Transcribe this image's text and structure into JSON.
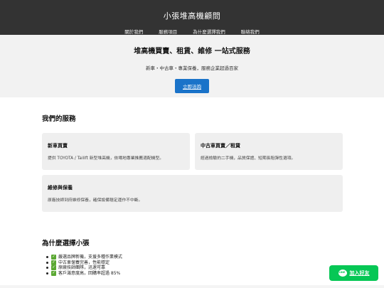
{
  "header": {
    "brand": "小張堆高機顧問",
    "nav": [
      "關於我們",
      "服務項目",
      "為什麼選擇我們",
      "聯絡我們"
    ]
  },
  "hero": {
    "title": "堆高機買賣、租賃、維修 一站式服務",
    "subtitle": "新車・中古車・專業保養，服務企業超過百家",
    "cta_label": "立即洽詢"
  },
  "services": {
    "title": "我們的服務",
    "cards": [
      {
        "title": "新車買賣",
        "desc": "提供 TOYOTA / Tailift 新型堆高機，依場地專業推薦適配機型。"
      },
      {
        "title": "中古車買賣／租賃",
        "desc": "經過檢驗的二手機，品質保證、短期長租彈性選項。"
      },
      {
        "title": "維修與保養",
        "desc": "原廠技師到府維修保養，確保設備穩定運作不中斷。"
      }
    ]
  },
  "why": {
    "title": "為什麼選擇小張",
    "items": [
      "嚴選品牌新機，支援多種作業模式",
      "中古車保養完善，性能穩定",
      "原廠技師團隊，迅速可靠",
      "客戶滿意度高，回購率超過 85%"
    ]
  },
  "line_button": {
    "label": "加入好友",
    "icon_text": "LINE"
  },
  "colors": {
    "header_bg": "#333333",
    "cta": "#1a73c9",
    "line_green": "#06c755",
    "check_green": "#5aa832"
  }
}
